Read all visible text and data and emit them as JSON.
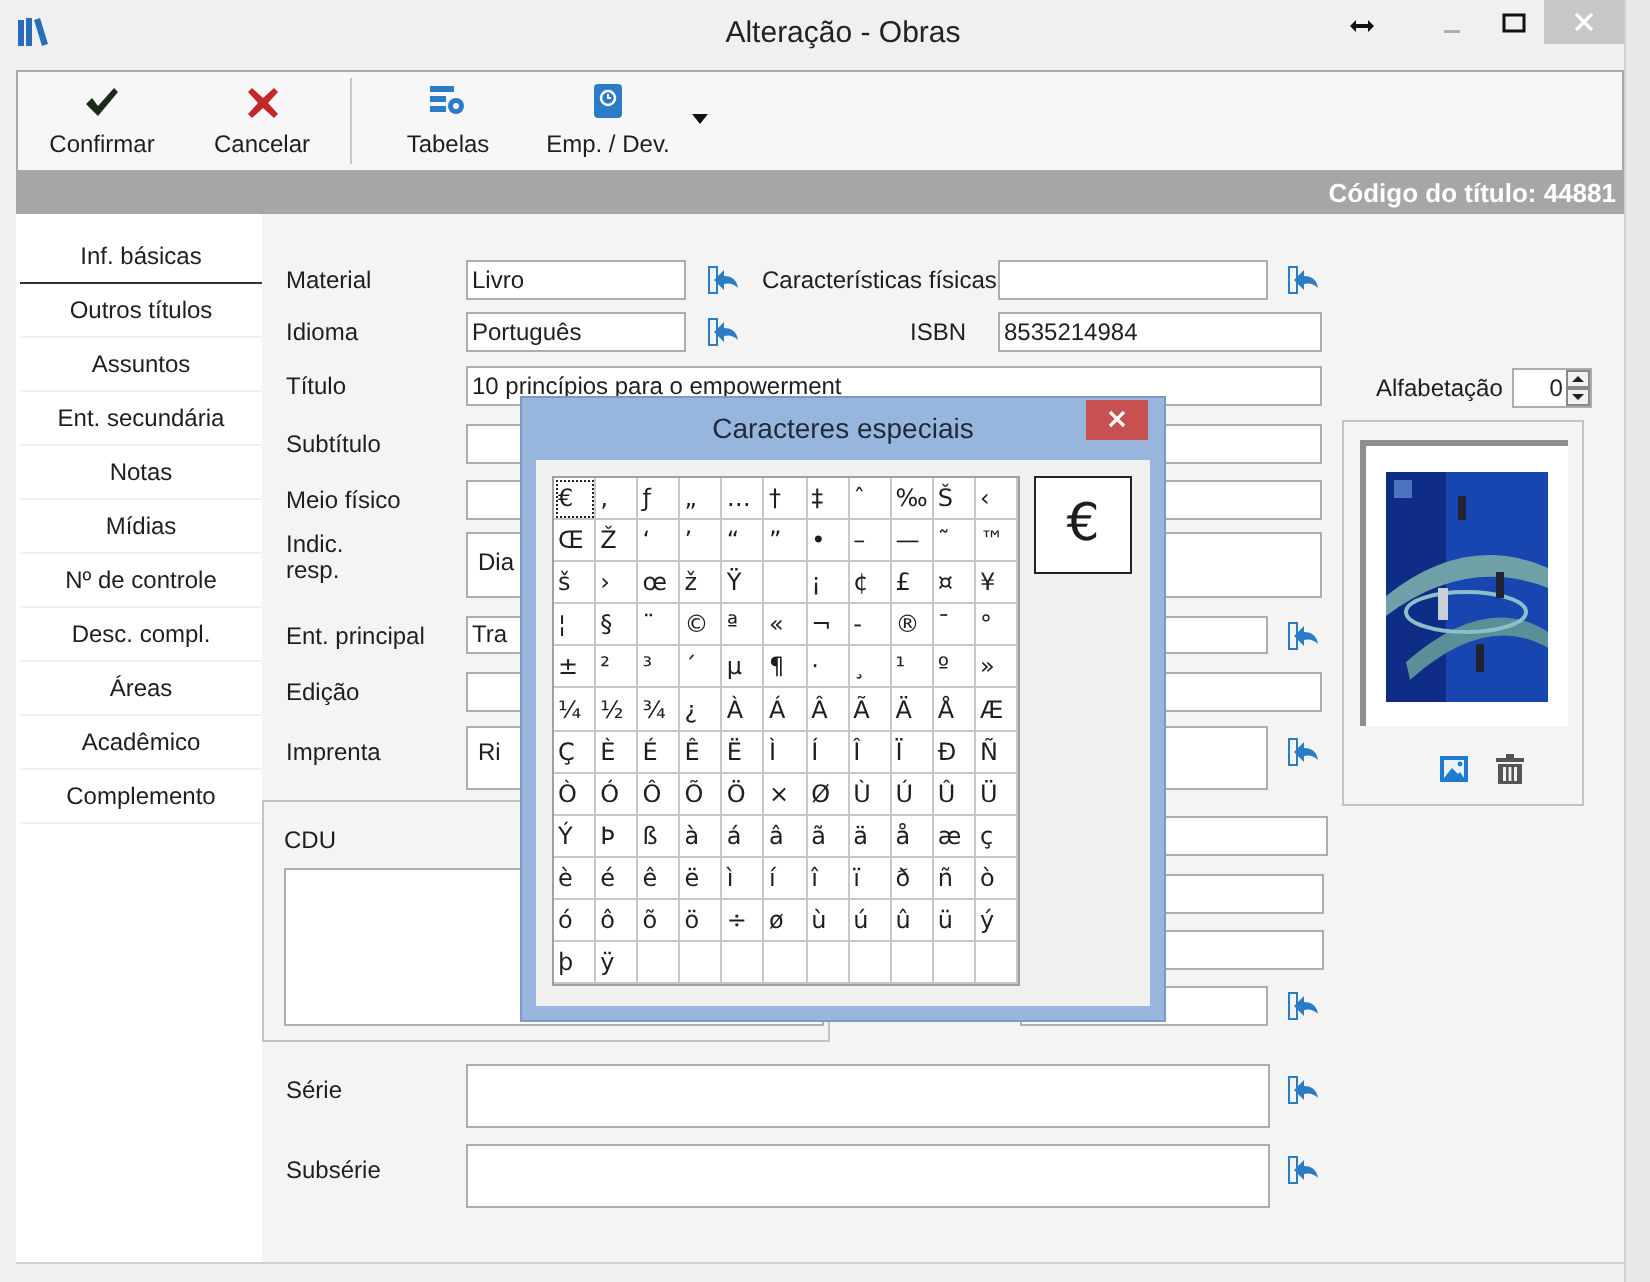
{
  "window": {
    "title": "Alteração - Obras"
  },
  "toolbar": [
    {
      "label": "Confirmar",
      "kind": "confirm",
      "dropdown": false
    },
    {
      "label": "Cancelar",
      "kind": "cancel",
      "dropdown": false
    },
    {
      "label": "Tabelas",
      "kind": "tables",
      "dropdown": false
    },
    {
      "label": "Emp. / Dev.",
      "kind": "loan",
      "dropdown": true
    }
  ],
  "header_band": {
    "text": "Código do título: 44881"
  },
  "sidebar": [
    {
      "label": "Inf. básicas",
      "selected": true
    },
    {
      "label": "Outros títulos",
      "selected": false
    },
    {
      "label": "Assuntos",
      "selected": false
    },
    {
      "label": "Ent. secundária",
      "selected": false
    },
    {
      "label": "Notas",
      "selected": false
    },
    {
      "label": "Mídias",
      "selected": false
    },
    {
      "label": "Nº de controle",
      "selected": false
    },
    {
      "label": "Desc. compl.",
      "selected": false
    },
    {
      "label": "Áreas",
      "selected": false
    },
    {
      "label": "Acadêmico",
      "selected": false
    },
    {
      "label": "Complemento",
      "selected": false
    }
  ],
  "form": {
    "material": {
      "label": "Material",
      "value": "Livro"
    },
    "physical": {
      "label": "Características físicas"
    },
    "language": {
      "label": "Idioma",
      "value": "Português"
    },
    "isbn": {
      "label": "ISBN",
      "value": "8535214984"
    },
    "title": {
      "label": "Título",
      "value": "10 princípios para o empowerment"
    },
    "alphabetization": {
      "label": "Alfabetação",
      "value": "0"
    },
    "subtitle": {
      "label": "Subtítulo"
    },
    "medium": {
      "label": "Meio físico"
    },
    "responsibility": {
      "label": "Indic.\nresp.",
      "value": "Dia"
    },
    "main_entity": {
      "label": "Ent. principal",
      "value": "Tra"
    },
    "edition": {
      "label": "Edição"
    },
    "imprint": {
      "label": "Imprenta",
      "value": "Ri"
    },
    "cdu": {
      "label": "CDU"
    },
    "series": {
      "label": "Série"
    },
    "subseries": {
      "label": "Subsérie"
    }
  },
  "dialog": {
    "title": "Caracteres especiais",
    "preview": "€",
    "rows": [
      [
        {
          "c": "€",
          "selected": true
        },
        {
          "c": "‚",
          "selected": false
        },
        {
          "c": "ƒ",
          "selected": false
        },
        {
          "c": "„",
          "selected": false
        },
        {
          "c": "…",
          "selected": false
        },
        {
          "c": "†",
          "selected": false
        },
        {
          "c": "‡",
          "selected": false
        },
        {
          "c": "ˆ",
          "selected": false
        },
        {
          "c": "‰",
          "selected": false
        },
        {
          "c": "Š",
          "selected": false
        },
        {
          "c": "‹",
          "selected": false
        }
      ],
      [
        {
          "c": "Œ",
          "selected": false
        },
        {
          "c": "Ž",
          "selected": false
        },
        {
          "c": "‘",
          "selected": false
        },
        {
          "c": "’",
          "selected": false
        },
        {
          "c": "“",
          "selected": false
        },
        {
          "c": "”",
          "selected": false
        },
        {
          "c": "•",
          "selected": false
        },
        {
          "c": "–",
          "selected": false
        },
        {
          "c": "—",
          "selected": false
        },
        {
          "c": "˜",
          "selected": false
        },
        {
          "c": "™",
          "selected": false
        }
      ],
      [
        {
          "c": "š",
          "selected": false
        },
        {
          "c": "›",
          "selected": false
        },
        {
          "c": "œ",
          "selected": false
        },
        {
          "c": "ž",
          "selected": false
        },
        {
          "c": "Ÿ",
          "selected": false
        },
        null,
        {
          "c": "¡",
          "selected": false
        },
        {
          "c": "¢",
          "selected": false
        },
        {
          "c": "£",
          "selected": false
        },
        {
          "c": "¤",
          "selected": false
        },
        {
          "c": "¥",
          "selected": false
        }
      ],
      [
        {
          "c": "¦",
          "selected": false
        },
        {
          "c": "§",
          "selected": false
        },
        {
          "c": "¨",
          "selected": false
        },
        {
          "c": "©",
          "selected": false
        },
        {
          "c": "ª",
          "selected": false
        },
        {
          "c": "«",
          "selected": false
        },
        {
          "c": "¬",
          "selected": false
        },
        {
          "c": "-",
          "selected": false
        },
        {
          "c": "®",
          "selected": false
        },
        {
          "c": "¯",
          "selected": false
        },
        {
          "c": "°",
          "selected": false
        }
      ],
      [
        {
          "c": "±",
          "selected": false
        },
        {
          "c": "²",
          "selected": false
        },
        {
          "c": "³",
          "selected": false
        },
        {
          "c": "´",
          "selected": false
        },
        {
          "c": "µ",
          "selected": false
        },
        {
          "c": "¶",
          "selected": false
        },
        {
          "c": "·",
          "selected": false
        },
        {
          "c": "¸",
          "selected": false
        },
        {
          "c": "¹",
          "selected": false
        },
        {
          "c": "º",
          "selected": false
        },
        {
          "c": "»",
          "selected": false
        }
      ],
      [
        {
          "c": "¼",
          "selected": false
        },
        {
          "c": "½",
          "selected": false
        },
        {
          "c": "¾",
          "selected": false
        },
        {
          "c": "¿",
          "selected": false
        },
        {
          "c": "À",
          "selected": false
        },
        {
          "c": "Á",
          "selected": false
        },
        {
          "c": "Â",
          "selected": false
        },
        {
          "c": "Ã",
          "selected": false
        },
        {
          "c": "Ä",
          "selected": false
        },
        {
          "c": "Å",
          "selected": false
        },
        {
          "c": "Æ",
          "selected": false
        }
      ],
      [
        {
          "c": "Ç",
          "selected": false
        },
        {
          "c": "È",
          "selected": false
        },
        {
          "c": "É",
          "selected": false
        },
        {
          "c": "Ê",
          "selected": false
        },
        {
          "c": "Ë",
          "selected": false
        },
        {
          "c": "Ì",
          "selected": false
        },
        {
          "c": "Í",
          "selected": false
        },
        {
          "c": "Î",
          "selected": false
        },
        {
          "c": "Ï",
          "selected": false
        },
        {
          "c": "Ð",
          "selected": false
        },
        {
          "c": "Ñ",
          "selected": false
        }
      ],
      [
        {
          "c": "Ò",
          "selected": false
        },
        {
          "c": "Ó",
          "selected": false
        },
        {
          "c": "Ô",
          "selected": false
        },
        {
          "c": "Õ",
          "selected": false
        },
        {
          "c": "Ö",
          "selected": false
        },
        {
          "c": "×",
          "selected": false
        },
        {
          "c": "Ø",
          "selected": false
        },
        {
          "c": "Ù",
          "selected": false
        },
        {
          "c": "Ú",
          "selected": false
        },
        {
          "c": "Û",
          "selected": false
        },
        {
          "c": "Ü",
          "selected": false
        }
      ],
      [
        {
          "c": "Ý",
          "selected": false
        },
        {
          "c": "Þ",
          "selected": false
        },
        {
          "c": "ß",
          "selected": false
        },
        {
          "c": "à",
          "selected": false
        },
        {
          "c": "á",
          "selected": false
        },
        {
          "c": "â",
          "selected": false
        },
        {
          "c": "ã",
          "selected": false
        },
        {
          "c": "ä",
          "selected": false
        },
        {
          "c": "å",
          "selected": false
        },
        {
          "c": "æ",
          "selected": false
        },
        {
          "c": "ç",
          "selected": false
        }
      ],
      [
        {
          "c": "è",
          "selected": false
        },
        {
          "c": "é",
          "selected": false
        },
        {
          "c": "ê",
          "selected": false
        },
        {
          "c": "ë",
          "selected": false
        },
        {
          "c": "ì",
          "selected": false
        },
        {
          "c": "í",
          "selected": false
        },
        {
          "c": "î",
          "selected": false
        },
        {
          "c": "ï",
          "selected": false
        },
        {
          "c": "ð",
          "selected": false
        },
        {
          "c": "ñ",
          "selected": false
        },
        {
          "c": "ò",
          "selected": false
        }
      ],
      [
        {
          "c": "ó",
          "selected": false
        },
        {
          "c": "ô",
          "selected": false
        },
        {
          "c": "õ",
          "selected": false
        },
        {
          "c": "ö",
          "selected": false
        },
        {
          "c": "÷",
          "selected": false
        },
        {
          "c": "ø",
          "selected": false
        },
        {
          "c": "ù",
          "selected": false
        },
        {
          "c": "ú",
          "selected": false
        },
        {
          "c": "û",
          "selected": false
        },
        {
          "c": "ü",
          "selected": false
        },
        {
          "c": "ý",
          "selected": false
        }
      ],
      [
        {
          "c": "þ",
          "selected": false
        },
        {
          "c": "ÿ",
          "selected": false
        },
        null,
        null,
        null,
        null,
        null,
        null,
        null,
        null,
        null
      ]
    ]
  }
}
